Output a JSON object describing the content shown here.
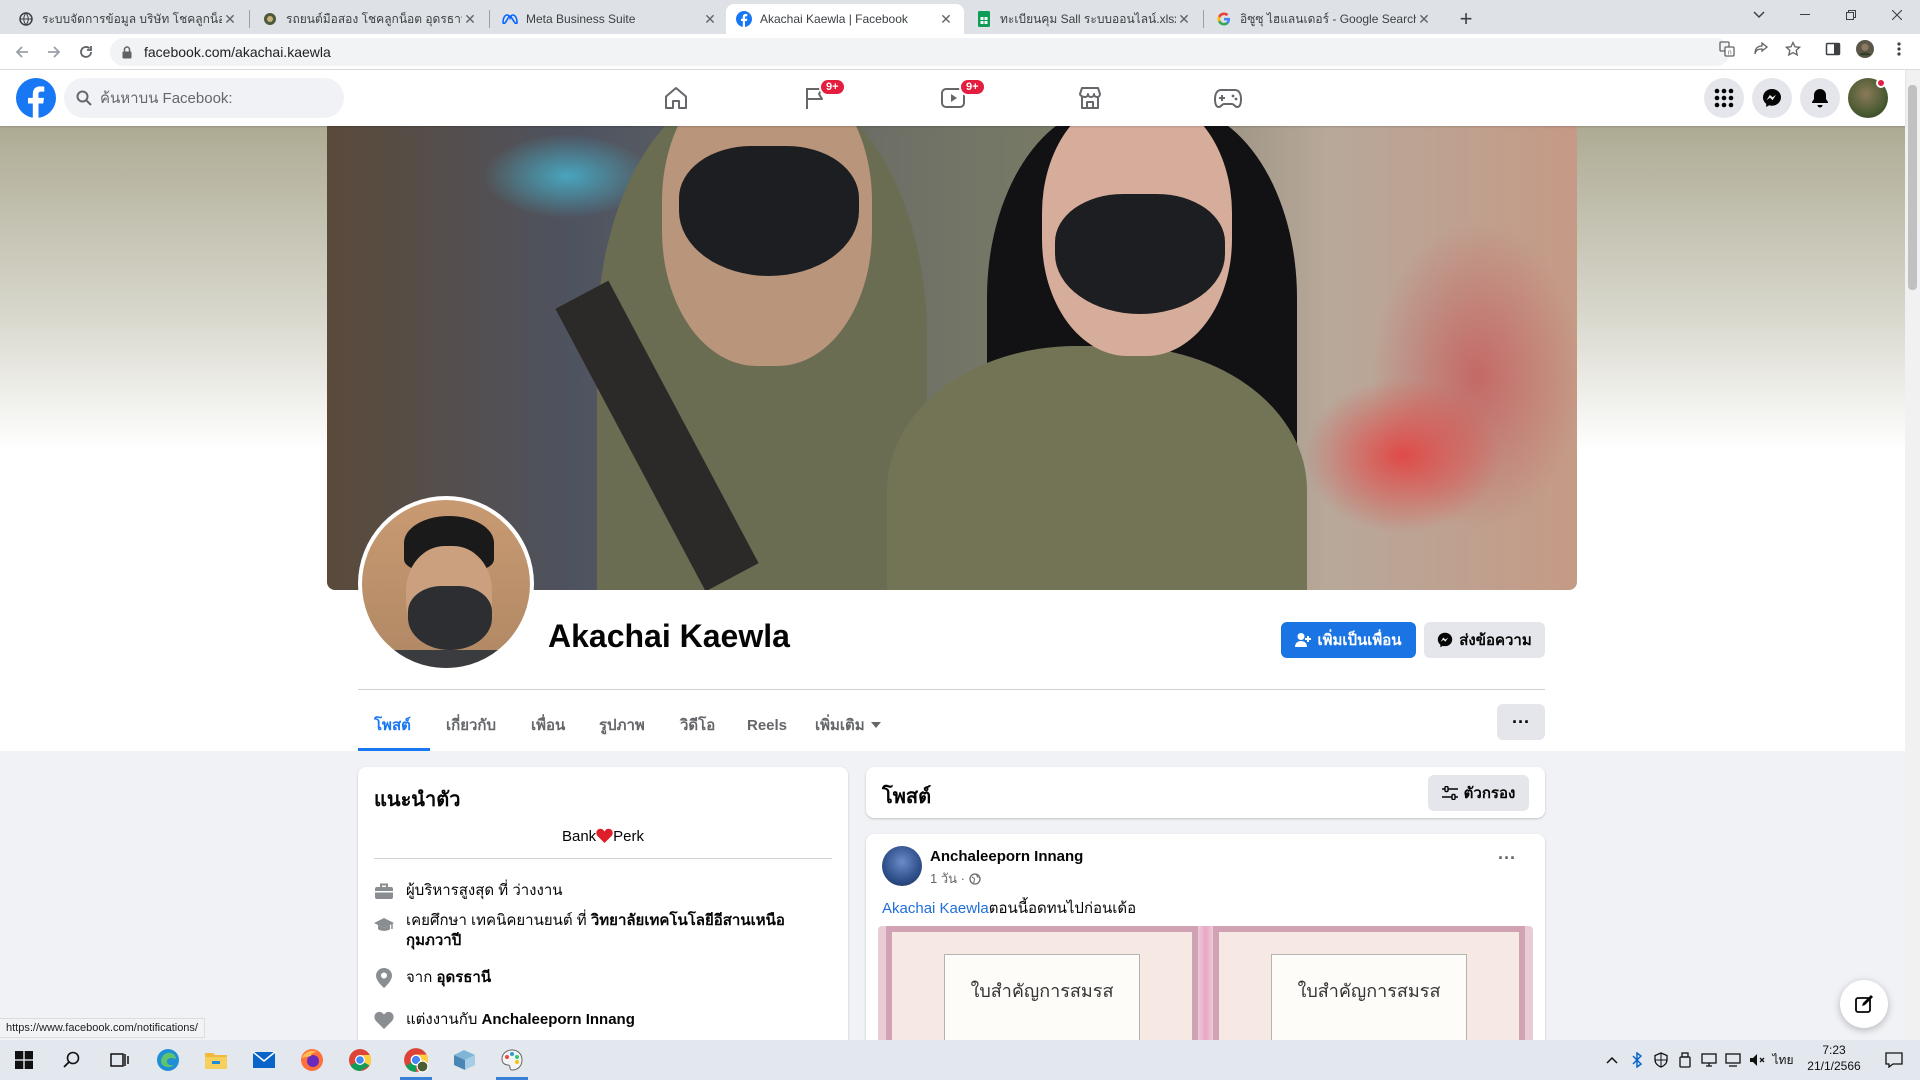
{
  "browser": {
    "tabs": [
      {
        "title": "ระบบจัดการข้อมูล บริษัท โชคลูกน็อต อ",
        "favicon": "globe-icon"
      },
      {
        "title": "รถยนต์มือสอง โชคลูกน็อต อุดรธานี",
        "favicon": "site-icon"
      },
      {
        "title": "Meta Business Suite",
        "favicon": "meta-icon"
      },
      {
        "title": "Akachai Kaewla | Facebook",
        "favicon": "facebook-icon"
      },
      {
        "title": "ทะเบียนคุม Sall ระบบออนไลน์.xlsx - G",
        "favicon": "sheets-icon"
      },
      {
        "title": "อิซูซุ ไฮแลนเดอร์ - Google Search",
        "favicon": "google-icon"
      }
    ],
    "active_tab_index": 3,
    "url": "facebook.com/akachai.kaewla",
    "status_url": "https://www.facebook.com/notifications/"
  },
  "fb_header": {
    "search_placeholder": "ค้นหาบน Facebook:",
    "nav": [
      {
        "icon": "home-icon",
        "badge": ""
      },
      {
        "icon": "flag-icon",
        "badge": "9+"
      },
      {
        "icon": "video-icon",
        "badge": "9+"
      },
      {
        "icon": "marketplace-icon",
        "badge": ""
      },
      {
        "icon": "gaming-icon",
        "badge": ""
      }
    ],
    "right_icons": [
      "menu-grid-icon",
      "messenger-icon",
      "notifications-icon",
      "account-avatar"
    ]
  },
  "profile": {
    "name": "Akachai Kaewla",
    "add_friend_label": "เพิ่มเป็นเพื่อน",
    "message_label": "ส่งข้อความ",
    "tabs": [
      "โพสต์",
      "เกี่ยวกับ",
      "เพื่อน",
      "รูปภาพ",
      "วิดีโอ",
      "Reels",
      "เพิ่มเติม"
    ],
    "active_tab": "โพสต์",
    "more_label": "···"
  },
  "intro": {
    "title": "แนะนำตัว",
    "bio_left": "Bank",
    "bio_right": "Perk",
    "rows": [
      {
        "icon": "briefcase-icon",
        "prefix": "ผู้บริหารสูงสุด ที่ ว่างงาน",
        "bold": ""
      },
      {
        "icon": "graduation-cap-icon",
        "prefix": "เคยศึกษา เทคนิคยานยนต์ ที่ ",
        "bold": "วิทยาลัยเทคโนโลยีอีสานเหนือ",
        "line2": "กุมภวาปี"
      },
      {
        "icon": "location-pin-icon",
        "prefix": "จาก ",
        "bold": "อุดรธานี"
      },
      {
        "icon": "heart-icon",
        "prefix": "แต่งงานกับ ",
        "bold": "Anchaleeporn Innang"
      }
    ]
  },
  "posts": {
    "header": "โพสต์",
    "filter_label": "ตัวกรอง",
    "items": [
      {
        "author": "Anchaleeporn Innang",
        "time": "1 วัน ·",
        "mention": "Akachai Kaewla",
        "text": "ตอนนี้อดทนไปก่อนเด้อ",
        "image_caption_left": "ใบสำคัญการสมรส",
        "image_caption_right": "ใบสำคัญการสมรส"
      }
    ]
  },
  "taskbar": {
    "apps": [
      "windows-start-icon",
      "search-icon",
      "task-view-icon",
      "edge-icon",
      "file-explorer-icon",
      "mail-icon",
      "firefox-icon",
      "chrome-icon",
      "chrome-profile-icon",
      "app-icon",
      "paint-icon"
    ],
    "language": "ไทย",
    "time": "7:23",
    "date": "21/1/2566"
  },
  "colors": {
    "fb_blue": "#1877f2",
    "badge_red": "#e41e3f",
    "button_blue": "#1b74e4"
  }
}
